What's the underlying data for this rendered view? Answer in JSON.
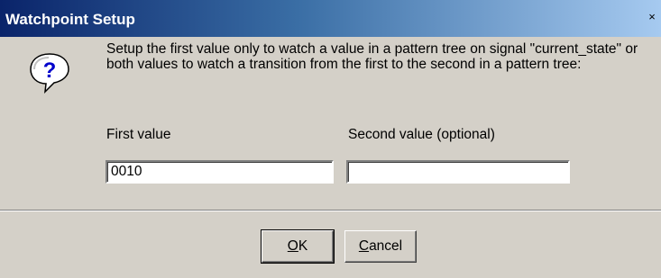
{
  "window": {
    "title": "Watchpoint Setup",
    "close_glyph": "×"
  },
  "message": {
    "icon": "question-icon",
    "text": "Setup the first value only to watch a value in a pattern tree on signal \"current_state\" or both values to watch a transition from the first to the second in a pattern tree:"
  },
  "fields": {
    "first": {
      "label": "First value",
      "value": "0010"
    },
    "second": {
      "label": "Second value (optional)",
      "value": ""
    }
  },
  "buttons": {
    "ok": {
      "mnemonic": "O",
      "rest": "K"
    },
    "cancel": {
      "mnemonic": "C",
      "rest": "ancel"
    }
  },
  "colors": {
    "title_gradient_start": "#0a246a",
    "title_gradient_end": "#a6caf0",
    "dialog_face": "#d4d0c8"
  }
}
